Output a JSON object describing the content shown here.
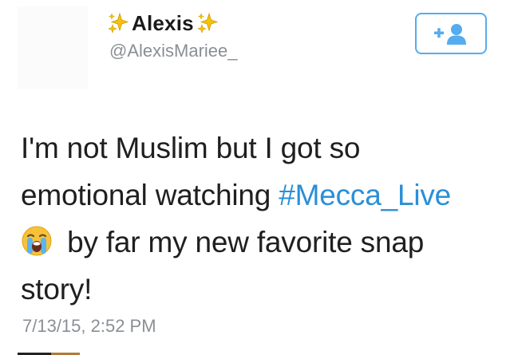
{
  "tweet": {
    "display_name": "Alexis",
    "handle": "@AlexisMariee_",
    "text_line1": "I'm not Muslim but I got so",
    "text_line2_prefix": "emotional watching ",
    "hashtag": "#Mecca_Live",
    "text_line3": " by far my new favorite snap",
    "text_line4": "story!",
    "timestamp": "7/13/15, 2:52 PM",
    "name_decoration_icon": "sparkles-icon",
    "emoji_icon": "loudly-crying-face-icon"
  },
  "follow_button": {
    "icon": "add-user-icon"
  },
  "colors": {
    "accent": "#55acee",
    "hashtag": "#2a8fd8",
    "secondary_text": "#8a8f95",
    "primary_text": "#1f1f1f"
  }
}
